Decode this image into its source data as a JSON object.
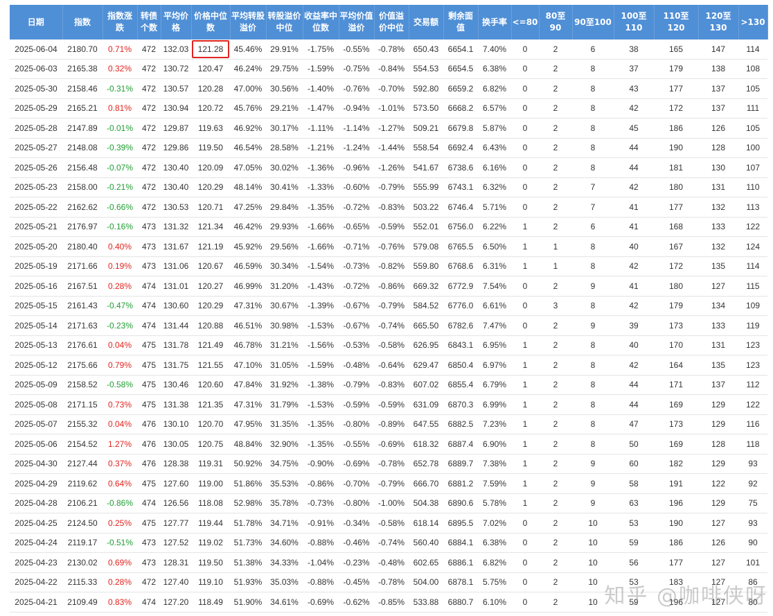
{
  "headers": [
    "日期",
    "指数",
    "指数涨跌",
    "转债个数",
    "平均价格",
    "价格中位数",
    "平均转股溢价",
    "转股溢价中位",
    "收益率中位数",
    "平均价值溢价",
    "价值溢价中位",
    "交易额",
    "剩余面值",
    "换手率",
    "<=80",
    "80至90",
    "90至100",
    "100至110",
    "110至120",
    "120至130",
    ">130"
  ],
  "rows": [
    [
      "2025-06-04",
      "2180.70",
      "0.71%",
      "472",
      "132.03",
      "121.28",
      "45.46%",
      "29.91%",
      "-1.75%",
      "-0.55%",
      "-0.78%",
      "650.43",
      "6654.1",
      "7.40%",
      "0",
      "2",
      "6",
      "38",
      "165",
      "147",
      "114"
    ],
    [
      "2025-06-03",
      "2165.38",
      "0.32%",
      "472",
      "130.72",
      "120.47",
      "46.24%",
      "29.75%",
      "-1.59%",
      "-0.75%",
      "-0.84%",
      "554.53",
      "6654.5",
      "6.38%",
      "0",
      "2",
      "8",
      "37",
      "179",
      "138",
      "108"
    ],
    [
      "2025-05-30",
      "2158.46",
      "-0.31%",
      "472",
      "130.57",
      "120.28",
      "47.00%",
      "30.56%",
      "-1.40%",
      "-0.76%",
      "-0.70%",
      "592.80",
      "6659.2",
      "6.82%",
      "0",
      "2",
      "8",
      "43",
      "177",
      "137",
      "105"
    ],
    [
      "2025-05-29",
      "2165.21",
      "0.81%",
      "472",
      "130.94",
      "120.72",
      "45.76%",
      "29.21%",
      "-1.47%",
      "-0.94%",
      "-1.01%",
      "573.50",
      "6668.2",
      "6.57%",
      "0",
      "2",
      "8",
      "42",
      "172",
      "137",
      "111"
    ],
    [
      "2025-05-28",
      "2147.89",
      "-0.01%",
      "472",
      "129.87",
      "119.63",
      "46.92%",
      "30.17%",
      "-1.11%",
      "-1.14%",
      "-1.27%",
      "509.21",
      "6679.8",
      "5.87%",
      "0",
      "2",
      "8",
      "45",
      "186",
      "126",
      "105"
    ],
    [
      "2025-05-27",
      "2148.08",
      "-0.39%",
      "472",
      "129.86",
      "119.50",
      "46.54%",
      "28.58%",
      "-1.21%",
      "-1.24%",
      "-1.44%",
      "558.54",
      "6692.4",
      "6.43%",
      "0",
      "2",
      "8",
      "44",
      "190",
      "128",
      "100"
    ],
    [
      "2025-05-26",
      "2156.48",
      "-0.07%",
      "472",
      "130.40",
      "120.09",
      "47.05%",
      "30.02%",
      "-1.36%",
      "-0.96%",
      "-1.26%",
      "541.67",
      "6738.6",
      "6.16%",
      "0",
      "2",
      "8",
      "44",
      "181",
      "130",
      "107"
    ],
    [
      "2025-05-23",
      "2158.00",
      "-0.21%",
      "472",
      "130.40",
      "120.29",
      "48.14%",
      "30.41%",
      "-1.33%",
      "-0.60%",
      "-0.79%",
      "555.99",
      "6743.1",
      "6.32%",
      "0",
      "2",
      "7",
      "42",
      "180",
      "131",
      "110"
    ],
    [
      "2025-05-22",
      "2162.62",
      "-0.66%",
      "472",
      "130.53",
      "120.71",
      "47.25%",
      "29.84%",
      "-1.35%",
      "-0.72%",
      "-0.83%",
      "503.22",
      "6746.4",
      "5.71%",
      "0",
      "2",
      "7",
      "41",
      "177",
      "132",
      "113"
    ],
    [
      "2025-05-21",
      "2176.97",
      "-0.16%",
      "473",
      "131.32",
      "121.34",
      "46.42%",
      "29.93%",
      "-1.66%",
      "-0.65%",
      "-0.59%",
      "552.01",
      "6756.0",
      "6.22%",
      "1",
      "2",
      "6",
      "41",
      "168",
      "133",
      "122"
    ],
    [
      "2025-05-20",
      "2180.40",
      "0.40%",
      "473",
      "131.67",
      "121.19",
      "45.92%",
      "29.56%",
      "-1.66%",
      "-0.71%",
      "-0.76%",
      "579.08",
      "6765.5",
      "6.50%",
      "1",
      "1",
      "8",
      "40",
      "167",
      "132",
      "124"
    ],
    [
      "2025-05-19",
      "2171.66",
      "0.19%",
      "473",
      "131.06",
      "120.67",
      "46.59%",
      "30.34%",
      "-1.54%",
      "-0.73%",
      "-0.82%",
      "559.80",
      "6768.6",
      "6.31%",
      "1",
      "1",
      "8",
      "42",
      "172",
      "135",
      "114"
    ],
    [
      "2025-05-16",
      "2167.51",
      "0.28%",
      "474",
      "131.01",
      "120.27",
      "46.99%",
      "31.20%",
      "-1.43%",
      "-0.72%",
      "-0.86%",
      "669.32",
      "6772.9",
      "7.54%",
      "0",
      "2",
      "9",
      "41",
      "180",
      "127",
      "115"
    ],
    [
      "2025-05-15",
      "2161.43",
      "-0.47%",
      "474",
      "130.60",
      "120.29",
      "47.31%",
      "30.67%",
      "-1.39%",
      "-0.67%",
      "-0.79%",
      "584.52",
      "6776.0",
      "6.61%",
      "0",
      "3",
      "8",
      "42",
      "179",
      "134",
      "109"
    ],
    [
      "2025-05-14",
      "2171.63",
      "-0.23%",
      "474",
      "131.44",
      "120.88",
      "46.51%",
      "30.98%",
      "-1.53%",
      "-0.67%",
      "-0.74%",
      "665.50",
      "6782.6",
      "7.47%",
      "0",
      "2",
      "9",
      "39",
      "173",
      "133",
      "119"
    ],
    [
      "2025-05-13",
      "2176.61",
      "0.04%",
      "475",
      "131.78",
      "121.49",
      "46.78%",
      "31.21%",
      "-1.56%",
      "-0.53%",
      "-0.58%",
      "626.95",
      "6843.1",
      "6.95%",
      "1",
      "2",
      "8",
      "40",
      "170",
      "131",
      "123"
    ],
    [
      "2025-05-12",
      "2175.66",
      "0.79%",
      "475",
      "131.75",
      "121.55",
      "47.10%",
      "31.05%",
      "-1.59%",
      "-0.48%",
      "-0.64%",
      "629.47",
      "6850.4",
      "6.97%",
      "1",
      "2",
      "8",
      "42",
      "164",
      "135",
      "123"
    ],
    [
      "2025-05-09",
      "2158.52",
      "-0.58%",
      "475",
      "130.46",
      "120.60",
      "47.84%",
      "31.92%",
      "-1.38%",
      "-0.79%",
      "-0.83%",
      "607.02",
      "6855.4",
      "6.79%",
      "1",
      "2",
      "8",
      "44",
      "171",
      "137",
      "112"
    ],
    [
      "2025-05-08",
      "2171.15",
      "0.73%",
      "475",
      "131.38",
      "121.35",
      "47.31%",
      "31.79%",
      "-1.53%",
      "-0.59%",
      "-0.59%",
      "631.09",
      "6870.3",
      "6.99%",
      "1",
      "2",
      "8",
      "44",
      "169",
      "129",
      "122"
    ],
    [
      "2025-05-07",
      "2155.32",
      "0.04%",
      "476",
      "130.10",
      "120.70",
      "47.95%",
      "31.35%",
      "-1.35%",
      "-0.80%",
      "-0.89%",
      "647.55",
      "6882.5",
      "7.23%",
      "1",
      "2",
      "8",
      "47",
      "173",
      "129",
      "116"
    ],
    [
      "2025-05-06",
      "2154.52",
      "1.27%",
      "476",
      "130.05",
      "120.75",
      "48.84%",
      "32.90%",
      "-1.35%",
      "-0.55%",
      "-0.69%",
      "618.32",
      "6887.4",
      "6.90%",
      "1",
      "2",
      "8",
      "50",
      "169",
      "128",
      "118"
    ],
    [
      "2025-04-30",
      "2127.44",
      "0.37%",
      "476",
      "128.38",
      "119.31",
      "50.92%",
      "34.75%",
      "-0.90%",
      "-0.69%",
      "-0.78%",
      "652.78",
      "6889.7",
      "7.38%",
      "1",
      "2",
      "9",
      "60",
      "182",
      "129",
      "93"
    ],
    [
      "2025-04-29",
      "2119.62",
      "0.64%",
      "475",
      "127.60",
      "119.00",
      "51.86%",
      "35.53%",
      "-0.86%",
      "-0.70%",
      "-0.79%",
      "666.70",
      "6881.2",
      "7.59%",
      "1",
      "2",
      "9",
      "58",
      "191",
      "122",
      "92"
    ],
    [
      "2025-04-28",
      "2106.21",
      "-0.86%",
      "474",
      "126.56",
      "118.08",
      "52.98%",
      "35.78%",
      "-0.73%",
      "-0.80%",
      "-1.00%",
      "504.38",
      "6890.6",
      "5.78%",
      "1",
      "2",
      "9",
      "63",
      "196",
      "129",
      "75"
    ],
    [
      "2025-04-25",
      "2124.50",
      "0.25%",
      "475",
      "127.77",
      "119.44",
      "51.78%",
      "34.71%",
      "-0.91%",
      "-0.34%",
      "-0.58%",
      "618.14",
      "6895.5",
      "7.02%",
      "0",
      "2",
      "10",
      "53",
      "190",
      "127",
      "93"
    ],
    [
      "2025-04-24",
      "2119.17",
      "-0.51%",
      "473",
      "127.52",
      "119.02",
      "51.73%",
      "34.60%",
      "-0.88%",
      "-0.46%",
      "-0.74%",
      "560.40",
      "6884.1",
      "6.38%",
      "0",
      "2",
      "10",
      "59",
      "186",
      "126",
      "90"
    ],
    [
      "2025-04-23",
      "2130.02",
      "0.69%",
      "473",
      "128.31",
      "119.50",
      "51.38%",
      "34.33%",
      "-1.04%",
      "-0.23%",
      "-0.48%",
      "602.65",
      "6886.1",
      "6.82%",
      "0",
      "2",
      "10",
      "56",
      "177",
      "127",
      "101"
    ],
    [
      "2025-04-22",
      "2115.33",
      "0.28%",
      "472",
      "127.40",
      "119.10",
      "51.93%",
      "35.03%",
      "-0.88%",
      "-0.45%",
      "-0.78%",
      "504.00",
      "6878.1",
      "5.75%",
      "0",
      "2",
      "10",
      "53",
      "183",
      "127",
      "86"
    ],
    [
      "2025-04-21",
      "2109.49",
      "0.83%",
      "474",
      "127.20",
      "118.49",
      "51.90%",
      "34.61%",
      "-0.69%",
      "-0.62%",
      "-0.85%",
      "533.88",
      "6880.7",
      "6.10%",
      "0",
      "2",
      "10",
      "59",
      "196",
      "127",
      "80"
    ]
  ],
  "highlight": {
    "row": 0,
    "col": 5
  },
  "colors": {
    "header_bg": "#4f8fd6",
    "up": "#e0241f",
    "down": "#1f9d32"
  },
  "watermark": "知乎 @咖啡侠呀"
}
